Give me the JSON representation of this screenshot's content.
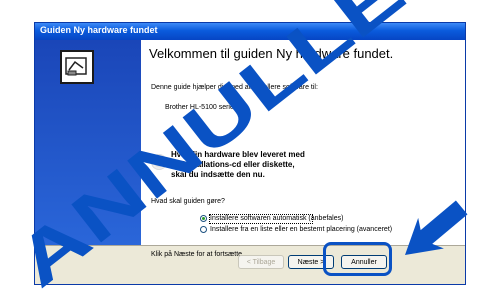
{
  "window": {
    "title": "Guiden Ny hardware fundet"
  },
  "content": {
    "heading": "Velkommen til guiden Ny hardware fundet.",
    "line1": "Denne guide hjælper dig med at installere software til:",
    "device": "Brother  HL-5100 series",
    "cd_line1": "Hvis din hardware blev leveret med",
    "cd_line2": "en installations-cd eller diskette,",
    "cd_line3": "skal du indsætte den nu.",
    "question": "Hvad skal guiden gøre?",
    "option1": "Installere softwaren automatisk (anbefales)",
    "option2": "Installere fra en liste eller en bestemt placering (avanceret)",
    "next_hint": "Klik på Næste for at fortsætte."
  },
  "buttons": {
    "back": "< Tilbage",
    "next": "Næste >",
    "cancel": "Annuller"
  },
  "overlay": {
    "watermark": "ANNULLER",
    "color": "#0a52c4"
  }
}
